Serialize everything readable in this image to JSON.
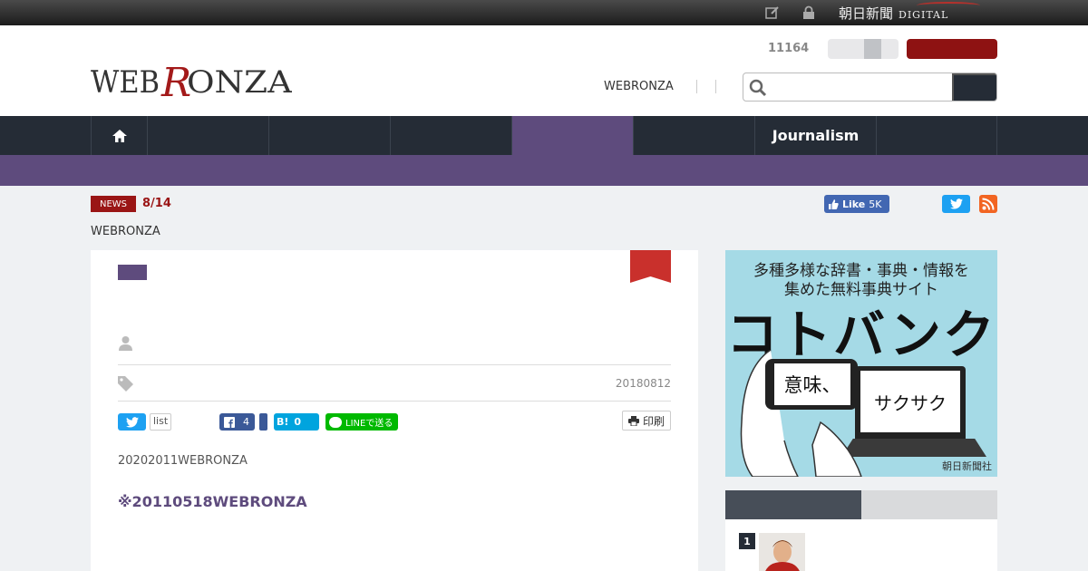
{
  "topbar": {
    "brand_main": "朝日新聞",
    "brand_sub": "DIGITAL",
    "icons": [
      "edit-icon",
      "lock-icon"
    ]
  },
  "header": {
    "logo_text": "WEBRONZA",
    "count": "11164",
    "link": "WEBRONZA",
    "search_placeholder": "",
    "colors": {
      "accent_red": "#8e1212",
      "nav_bg": "#252c36",
      "purple": "#5e4b7d"
    }
  },
  "nav": {
    "items": [
      {
        "label": "",
        "icon": "home-icon"
      },
      {
        "label": ""
      },
      {
        "label": ""
      },
      {
        "label": ""
      },
      {
        "label": "",
        "active": true
      },
      {
        "label": ""
      },
      {
        "label": "Journalism"
      },
      {
        "label": ""
      }
    ]
  },
  "news": {
    "badge": "NEWS",
    "date": "8/14",
    "breadcrumb": "WEBRONZA",
    "fb_like": "Like",
    "fb_count": "5K"
  },
  "article": {
    "date": "20180812",
    "share": {
      "list_label": "list",
      "fb_count": "4",
      "hatena_label": "B!",
      "hatena_count": "0",
      "line_label": "LINEで送る",
      "print_label": "印刷"
    },
    "lead": "20202011WEBRONZA",
    "link_title": "※20110518WEBRONZA"
  },
  "sidebar": {
    "ad": {
      "line1": "多種多様な辞書・事典・情報を",
      "line2": "集めた無料事典サイト",
      "headline": "コトバンク",
      "phone_text": "意味、",
      "laptop_text": "サクサク",
      "credit": "朝日新聞社"
    },
    "ranking": {
      "first_rank": "1"
    }
  }
}
